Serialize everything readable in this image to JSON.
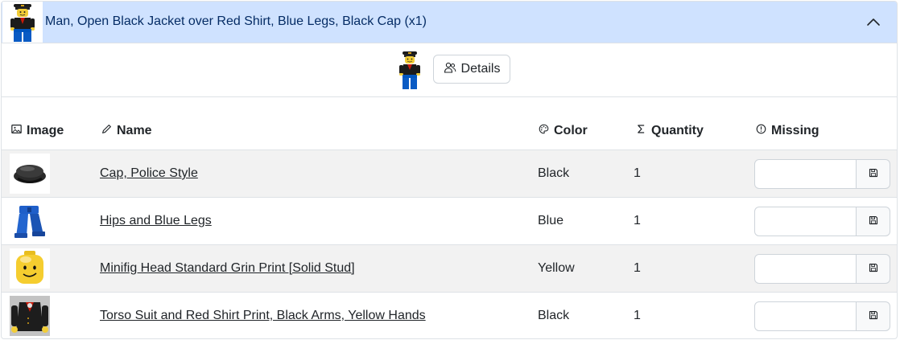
{
  "header": {
    "title": "Man, Open Black Jacket over Red Shirt, Blue Legs, Black Cap (x1)",
    "thumbnail_icon": "minifigure-image",
    "collapse_icon": "chevron-up-icon"
  },
  "details": {
    "button_label": "Details",
    "button_icon": "people-icon"
  },
  "table": {
    "columns": [
      {
        "label": "Image",
        "icon": "image-icon"
      },
      {
        "label": "Name",
        "icon": "pencil-icon"
      },
      {
        "label": "Color",
        "icon": "palette-icon"
      },
      {
        "label": "Quantity",
        "icon": "sigma-icon"
      },
      {
        "label": "Missing",
        "icon": "exclamation-circle-icon"
      }
    ],
    "rows": [
      {
        "name": "Cap, Police Style",
        "color": "Black",
        "quantity": "1",
        "missing": "",
        "image": "police-cap-image"
      },
      {
        "name": "Hips and Blue Legs",
        "color": "Blue",
        "quantity": "1",
        "missing": "",
        "image": "blue-legs-image"
      },
      {
        "name": "Minifig Head Standard Grin Print [Solid Stud]",
        "color": "Yellow",
        "quantity": "1",
        "missing": "",
        "image": "yellow-head-image"
      },
      {
        "name": "Torso Suit and Red Shirt Print, Black Arms, Yellow Hands",
        "color": "Black",
        "quantity": "1",
        "missing": "",
        "image": "torso-image"
      }
    ],
    "save_icon": "floppy-disk-icon"
  },
  "colors": {
    "header_bg": "#cfe2ff",
    "header_text": "#052c65",
    "row_shade": "#f2f2f2",
    "border": "#dee2e6"
  }
}
